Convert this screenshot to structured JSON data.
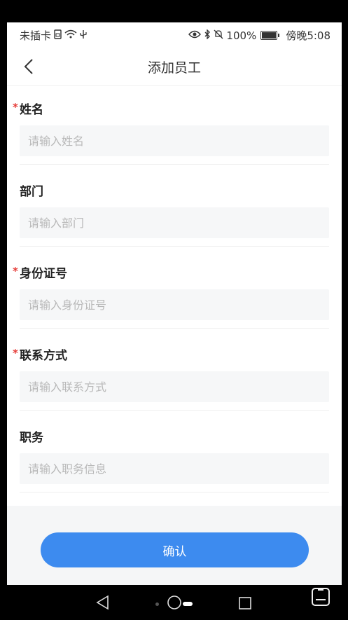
{
  "status_bar": {
    "carrier": "未插卡",
    "battery": "100%",
    "time": "傍晚5:08"
  },
  "nav": {
    "title": "添加员工"
  },
  "form": {
    "fields": [
      {
        "label": "姓名",
        "required": true,
        "placeholder": "请输入姓名",
        "value": ""
      },
      {
        "label": "部门",
        "required": false,
        "placeholder": "请输入部门",
        "value": ""
      },
      {
        "label": "身份证号",
        "required": true,
        "placeholder": "请输入身份证号",
        "value": ""
      },
      {
        "label": "联系方式",
        "required": true,
        "placeholder": "请输入联系方式",
        "value": ""
      },
      {
        "label": "职务",
        "required": false,
        "placeholder": "请输入职务信息",
        "value": ""
      }
    ],
    "required_mark": "*"
  },
  "footer": {
    "confirm_label": "确认"
  },
  "colors": {
    "accent": "#3d8bef",
    "required": "#e53935",
    "input_bg": "#f6f7f8",
    "footer_bg": "#f5f6f7"
  },
  "icons": {
    "status": [
      "sim-card-icon",
      "wifi-icon",
      "usb-icon",
      "eye-icon",
      "bluetooth-icon",
      "mute-icon",
      "battery-icon"
    ],
    "nav": [
      "back-chevron-icon"
    ],
    "system": [
      "system-back-icon",
      "system-home-icon",
      "system-recent-icon",
      "floating-window-icon"
    ]
  }
}
